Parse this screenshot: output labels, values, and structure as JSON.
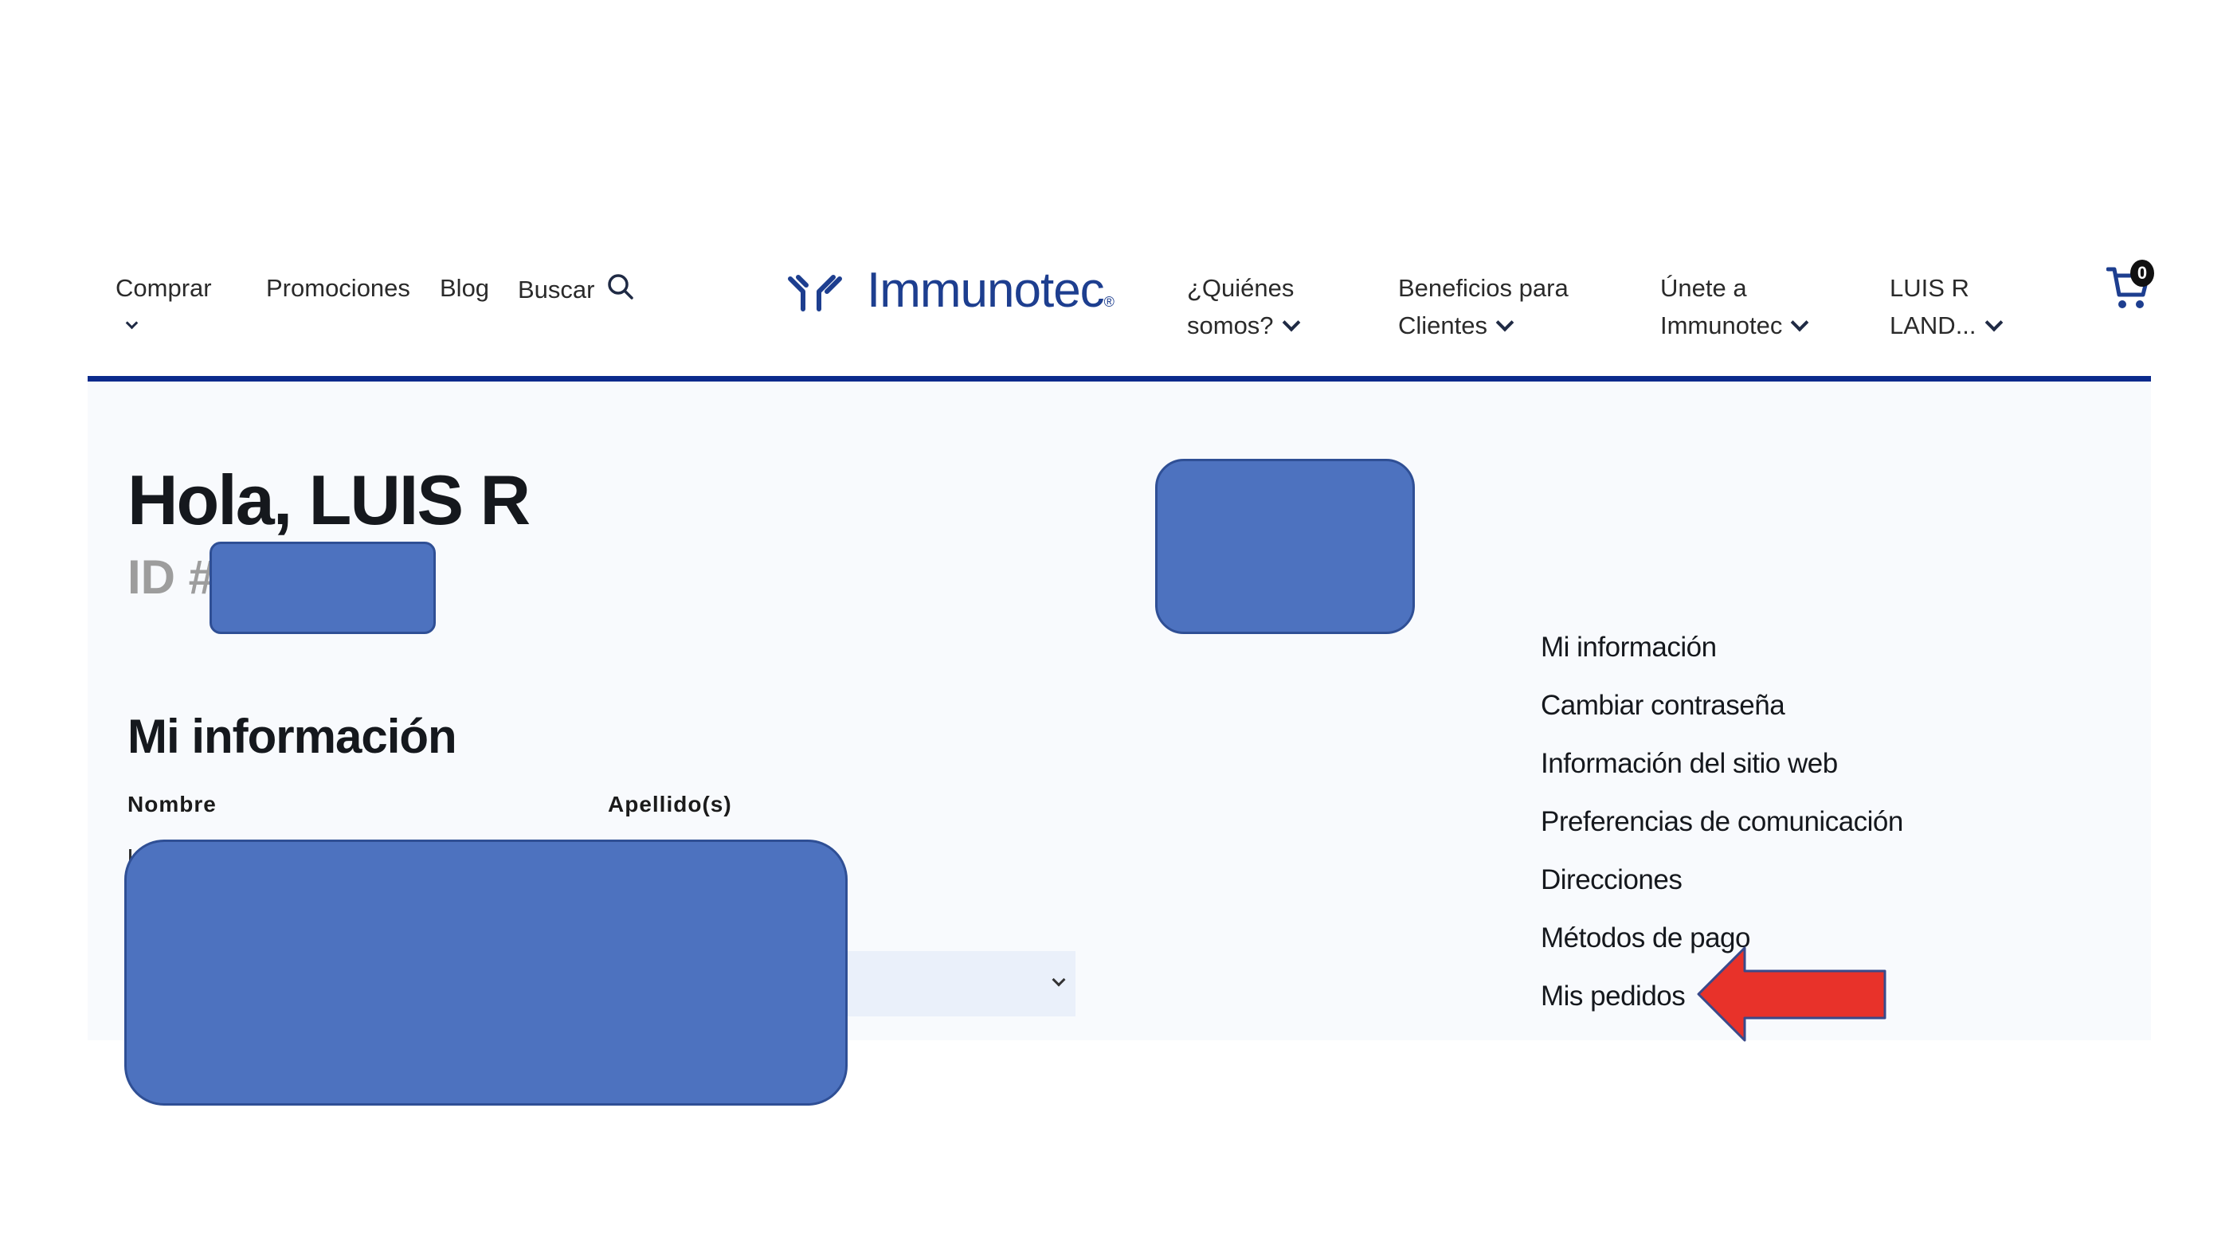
{
  "header": {
    "nav_left": {
      "shop": "Comprar",
      "promotions": "Promociones",
      "blog": "Blog",
      "search": "Buscar"
    },
    "logo_text": "Immunotec",
    "logo_mark": "®",
    "nav_right": {
      "about_line1": "¿Quiénes",
      "about_line2": "somos?",
      "benefits_line1": "Beneficios para",
      "benefits_line2": "Clientes",
      "join_line1": "Únete a",
      "join_line2": "Immunotec",
      "user_line1": "LUIS R",
      "user_line2": "LAND..."
    },
    "cart_count": "0",
    "accent_color": "#0b2a8c"
  },
  "profile": {
    "greeting": "Hola, LUIS R",
    "id_label": "ID #"
  },
  "info_section": {
    "title": "Mi información",
    "first_name_label": "Nombre",
    "last_name_label": "Apellido(s)"
  },
  "account_menu": {
    "items": [
      "Mi información",
      "Cambiar contraseña",
      "Información del sitio web",
      "Preferencias de comunicación",
      "Direcciones",
      "Métodos de pago",
      "Mis pedidos"
    ]
  },
  "colors": {
    "redaction_fill": "#4d72bf",
    "arrow_fill": "#e8322a"
  },
  "icons": {
    "search": "search-icon",
    "cart": "cart-icon",
    "chevron": "chevron-down-icon",
    "annotation": "arrow-left-icon"
  }
}
